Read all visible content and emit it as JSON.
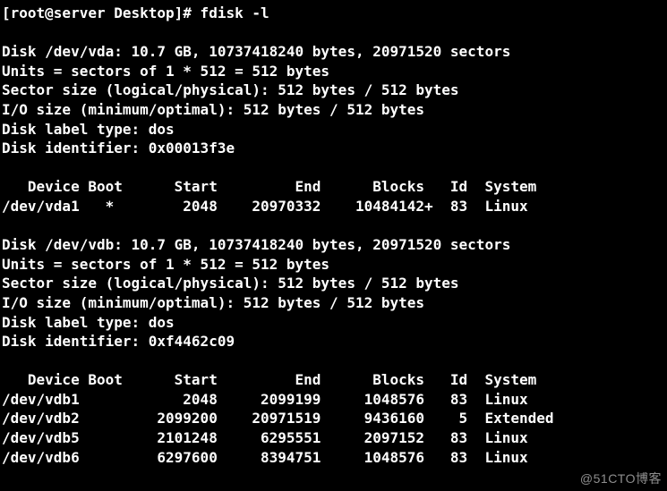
{
  "prompt": "[root@server Desktop]# fdisk -l",
  "blank": "",
  "disks": [
    {
      "header": "Disk /dev/vda: 10.7 GB, 10737418240 bytes, 20971520 sectors",
      "units": "Units = sectors of 1 * 512 = 512 bytes",
      "sector": "Sector size (logical/physical): 512 bytes / 512 bytes",
      "io": "I/O size (minimum/optimal): 512 bytes / 512 bytes",
      "label": "Disk label type: dos",
      "ident": "Disk identifier: 0x00013f3e",
      "thead": "   Device Boot      Start         End      Blocks   Id  System",
      "rows": [
        "/dev/vda1   *        2048    20970332    10484142+  83  Linux"
      ]
    },
    {
      "header": "Disk /dev/vdb: 10.7 GB, 10737418240 bytes, 20971520 sectors",
      "units": "Units = sectors of 1 * 512 = 512 bytes",
      "sector": "Sector size (logical/physical): 512 bytes / 512 bytes",
      "io": "I/O size (minimum/optimal): 512 bytes / 512 bytes",
      "label": "Disk label type: dos",
      "ident": "Disk identifier: 0xf4462c09",
      "thead": "   Device Boot      Start         End      Blocks   Id  System",
      "rows": [
        "/dev/vdb1            2048     2099199     1048576   83  Linux",
        "/dev/vdb2         2099200    20971519     9436160    5  Extended",
        "/dev/vdb5         2101248     6295551     2097152   83  Linux",
        "/dev/vdb6         6297600     8394751     1048576   83  Linux"
      ]
    }
  ],
  "watermark": "@51CTO博客"
}
